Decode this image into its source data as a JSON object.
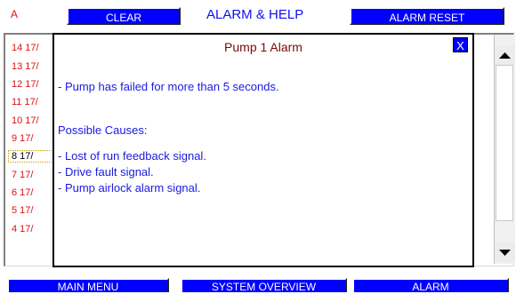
{
  "header": {
    "a_label": "A",
    "clear_label": "CLEAR",
    "title": "ALARM & HELP",
    "reset_label": "ALARM RESET"
  },
  "alarm_list": {
    "rows": [
      "14 17/",
      "13 17/",
      "12 17/",
      "11 17/",
      "10 17/",
      "9  17/",
      "8  17/",
      "7  17/",
      "6  17/",
      "5  17/",
      "4  17/"
    ]
  },
  "popup": {
    "title": "Pump 1 Alarm",
    "close_label": "X",
    "lines": [
      "- Pump has failed for more than 5 seconds.",
      "Possible Causes:",
      "- Lost of run feedback signal.",
      "- Drive fault signal.",
      "- Pump airlock alarm signal."
    ]
  },
  "footer": {
    "main_menu": "MAIN MENU",
    "system_overview": "SYSTEM OVERVIEW",
    "alarm": "ALARM"
  },
  "icons": {
    "scroll_up": "scroll-up-arrow",
    "scroll_down": "scroll-down-arrow"
  }
}
